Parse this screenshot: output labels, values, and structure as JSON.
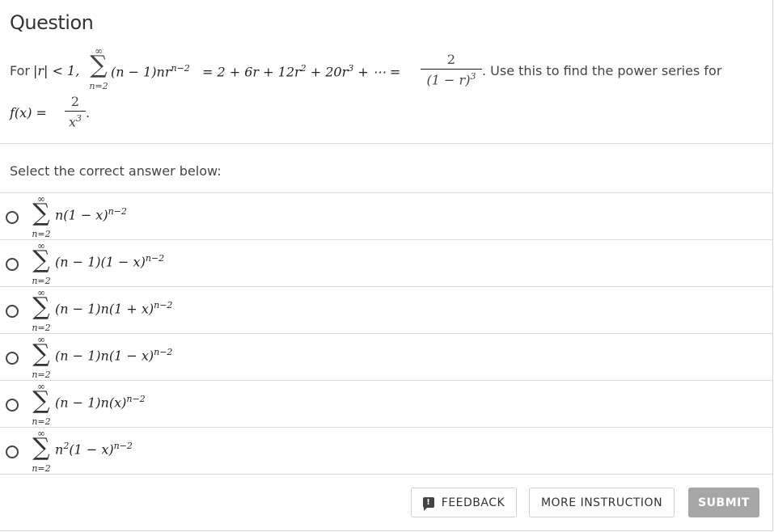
{
  "header": {
    "title": "Question"
  },
  "stem": {
    "prefix": "For",
    "condition": "|r| < 1,",
    "sum_upper": "∞",
    "sum_symbol": "∑",
    "sum_lower": "n=2",
    "summand": "(n − 1)nr",
    "summand_exp": "n−2",
    "expansion": "= 2 + 6r + 12r",
    "exp2": "2",
    "expansion_b": " + 20r",
    "exp3": "3",
    "expansion_c": " + ⋯ =",
    "frac_num": "2",
    "frac_den": "(1 − r)",
    "frac_den_exp": "3",
    "suffix": ". Use this to find the power series for",
    "f_label": "f(x) =",
    "f_num": "2",
    "f_den": "x",
    "f_den_exp": "3",
    "f_end": "."
  },
  "prompt": "Select the correct answer below:",
  "options": [
    {
      "upper": "∞",
      "sigma": "∑",
      "lower": "n=2",
      "body": "n(1 − x)",
      "exp": "n−2"
    },
    {
      "upper": "∞",
      "sigma": "∑",
      "lower": "n=2",
      "body": "(n − 1)(1 − x)",
      "exp": "n−2"
    },
    {
      "upper": "∞",
      "sigma": "∑",
      "lower": "n=2",
      "body": "(n − 1)n(1 + x)",
      "exp": "n−2"
    },
    {
      "upper": "∞",
      "sigma": "∑",
      "lower": "n=2",
      "body": "(n − 1)n(1 − x)",
      "exp": "n−2"
    },
    {
      "upper": "∞",
      "sigma": "∑",
      "lower": "n=2",
      "body": "(n − 1)n(x)",
      "exp": "n−2"
    },
    {
      "upper": "∞",
      "sigma": "∑",
      "lower": "n=2",
      "body_a": "n",
      "body_a_exp": "2",
      "body": "(1 − x)",
      "exp": "n−2"
    }
  ],
  "buttons": {
    "feedback": "FEEDBACK",
    "feedback_icon": "!",
    "more_instruction": "MORE INSTRUCTION",
    "submit": "SUBMIT"
  }
}
